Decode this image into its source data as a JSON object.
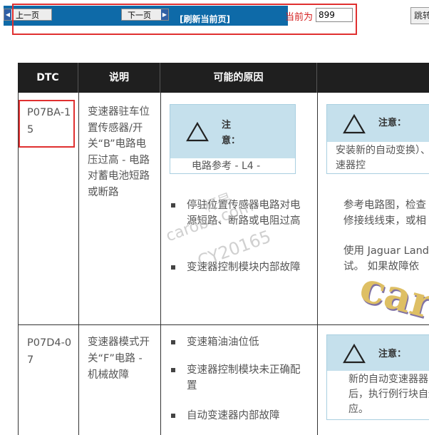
{
  "nav": {
    "prev_label": "上一页",
    "next_label": "下一页",
    "refresh_label": "[刷新当前页]",
    "current_label": "当前为",
    "current_value": "899",
    "jump_label": "跳转"
  },
  "table": {
    "headers": [
      "DTC",
      "说明",
      "可能的原因",
      ""
    ],
    "rows": [
      {
        "code": "P07BA-15",
        "description": "变速器驻车位置传感器/开关“B”电路电压过高 - 电路对蓄电池短路或断路",
        "note_title": "注意：",
        "note_body": "电路参考 - L4 -",
        "causes": [
          "停驻位置传感器电路对电源短路、断路或电阻过高",
          "变速器控制模块内部故障"
        ],
        "action_note_title": "注意：",
        "action_note_body": "安装新的自动变换）、变速器控",
        "actions": [
          "参考电路图，检查修接线线束，或相",
          "使用 Jaguar Land试。 如果故障依"
        ]
      },
      {
        "code": "P07D4-07",
        "description": "变速器模式开关“F”电路 - 机械故障",
        "causes": [
          "变速箱油油位低",
          "变速器控制模块未正确配置",
          "自动变速器内部故障"
        ],
        "action_note_title": "注意：",
        "action_note_body": "新的自动变速器器后，执行例行块自适应。"
      }
    ]
  },
  "watermark": {
    "line1": "杯易",
    "line2": "carobo.com",
    "line3": "CY20165",
    "logo": "car"
  }
}
